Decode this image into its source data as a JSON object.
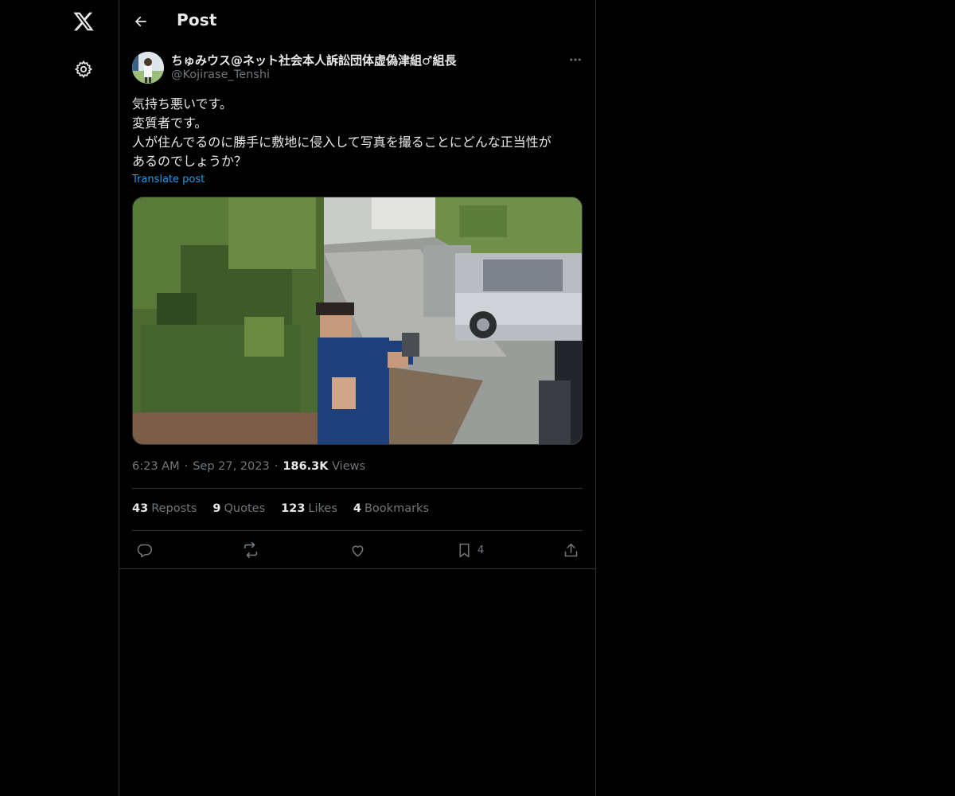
{
  "nav": {
    "logo_icon": "x-logo-icon",
    "settings_icon": "gear-icon"
  },
  "header": {
    "back_icon": "arrow-left-icon",
    "title": "Post"
  },
  "post": {
    "author": {
      "display_name": "ちゅみウス@ネット社会本人訴訟団体虚偽津組♂組長",
      "handle": "@Kojirase_Tenshi"
    },
    "text_lines": [
      "気持ち悪いです。",
      "変質者です。",
      "人が住んでるのに勝手に敷地に侵入して写真を撮ることにどんな正当性が",
      "あるのでしょうか？"
    ],
    "translate_label": "Translate post",
    "time": "6:23 AM",
    "date": "Sep 27, 2023",
    "views_count": "186.3K",
    "views_label": "Views",
    "stats": {
      "reposts_count": "43",
      "reposts_label": "Reposts",
      "quotes_count": "9",
      "quotes_label": "Quotes",
      "likes_count": "123",
      "likes_label": "Likes",
      "bookmarks_count": "4",
      "bookmarks_label": "Bookmarks"
    },
    "actions": {
      "bookmark_count": "4"
    }
  },
  "colors": {
    "background": "#000000",
    "border": "#2f3336",
    "text_primary": "#e7e9ea",
    "text_secondary": "#71767b",
    "accent": "#1d9bf0"
  }
}
